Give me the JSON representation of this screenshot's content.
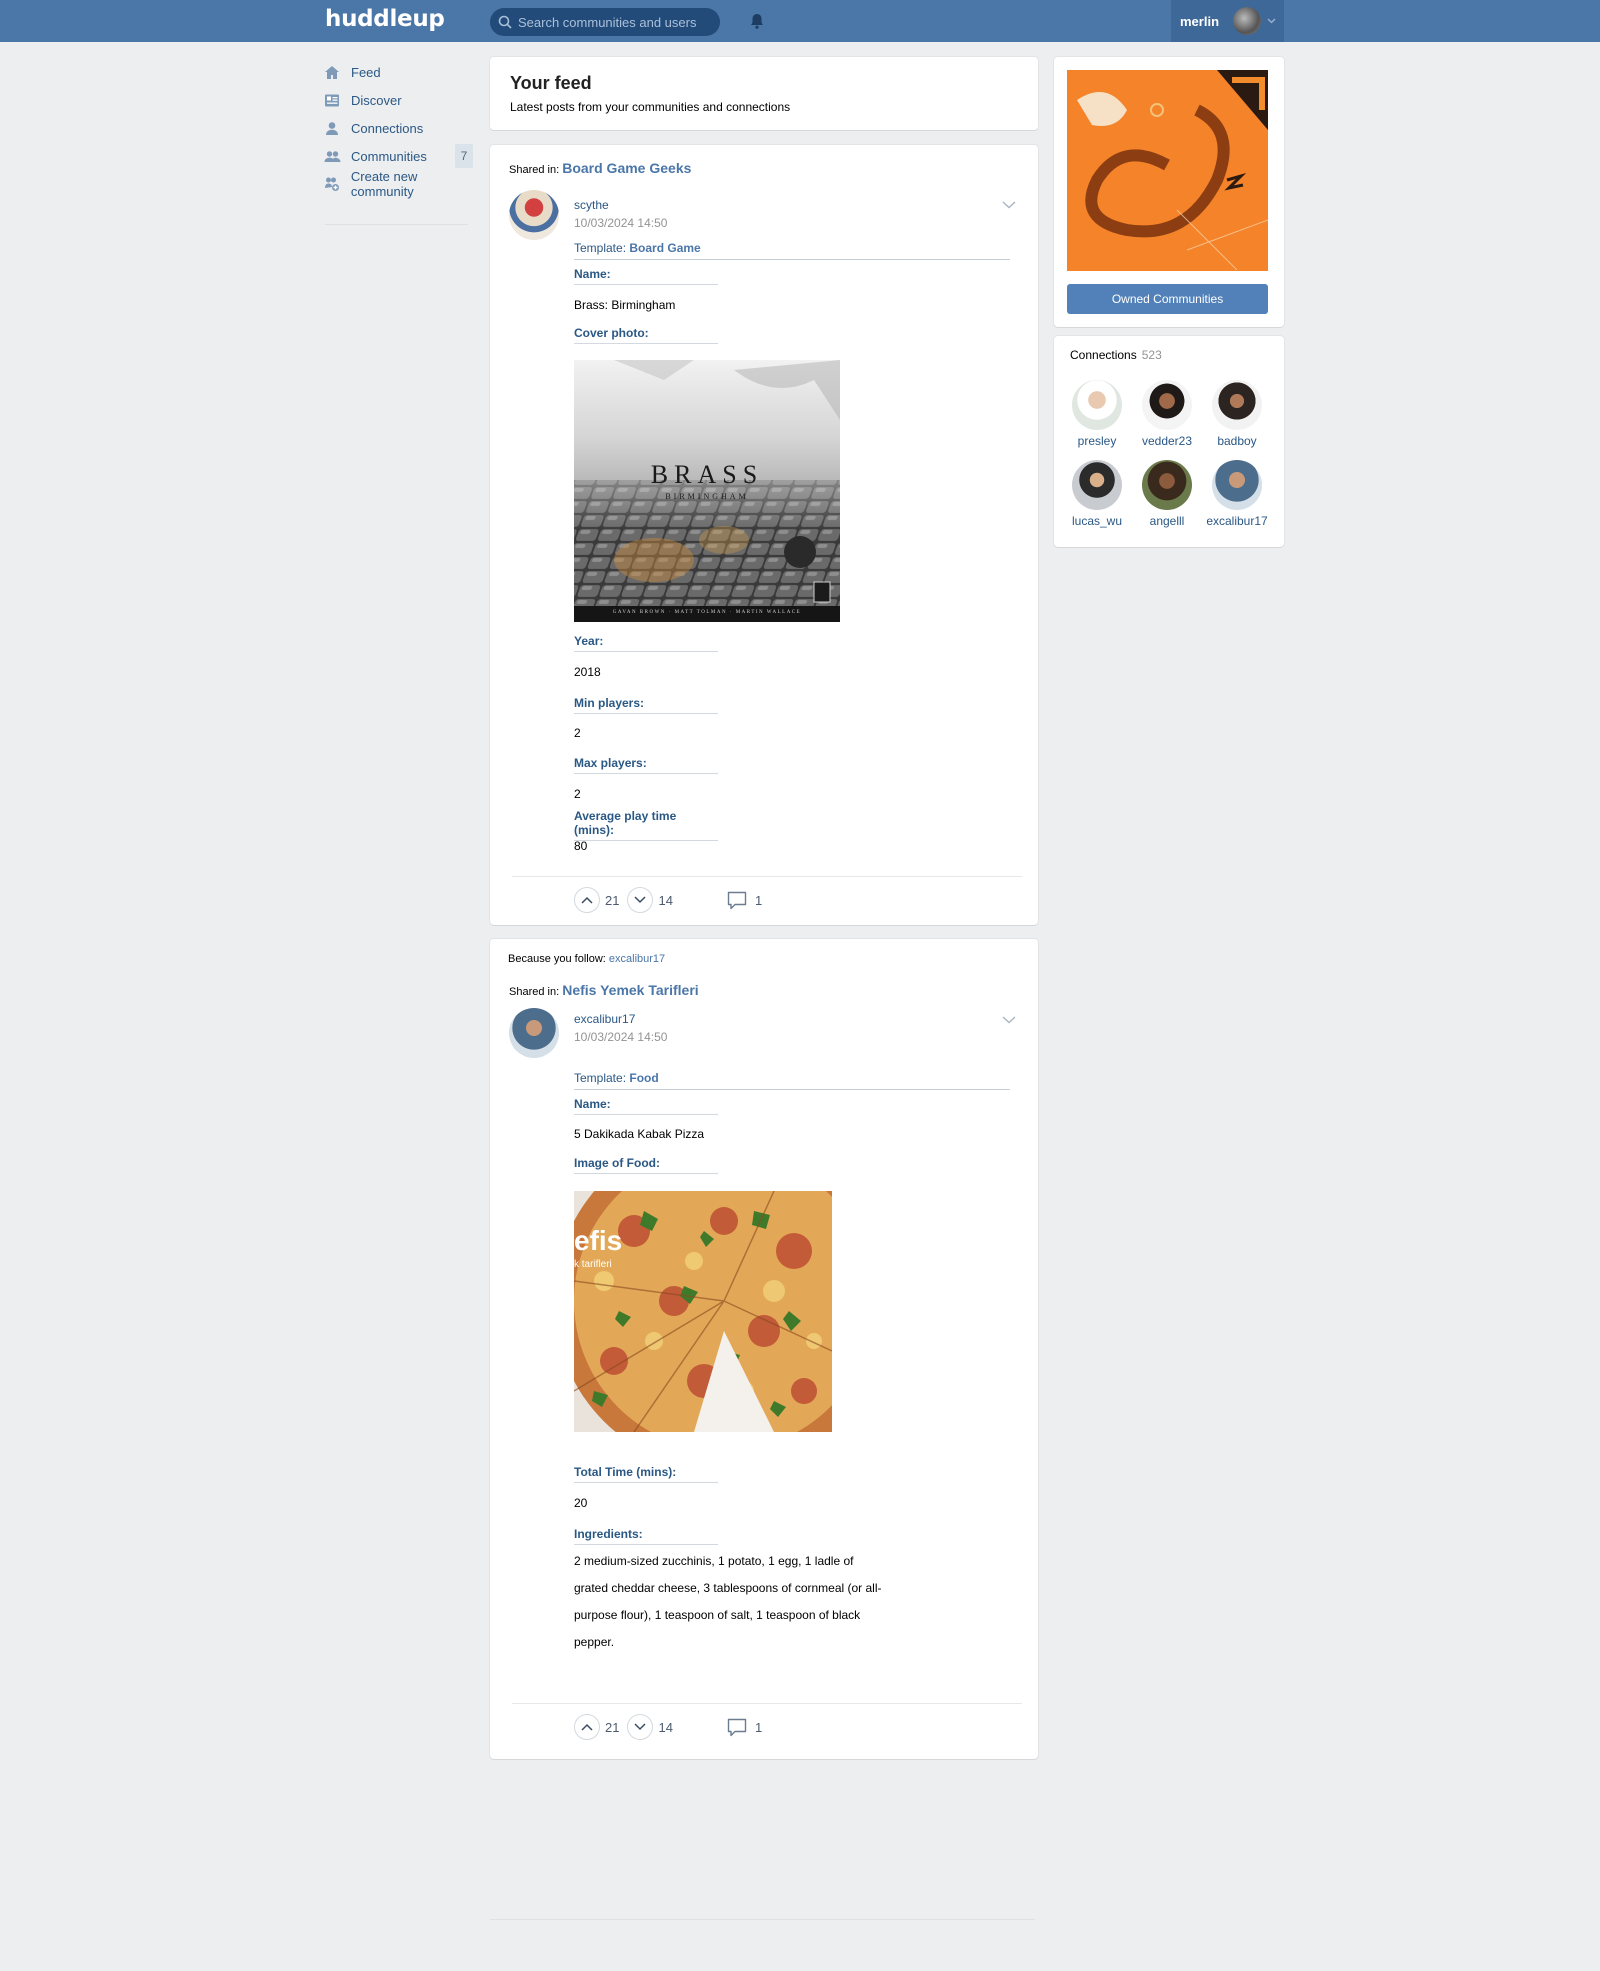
{
  "header": {
    "logo": "huddleup",
    "search_placeholder": "Search communities and users",
    "username": "merlin"
  },
  "nav": {
    "items": [
      {
        "label": "Feed",
        "icon": "home-icon"
      },
      {
        "label": "Discover",
        "icon": "newspaper-icon"
      },
      {
        "label": "Connections",
        "icon": "user-icon"
      },
      {
        "label": "Communities",
        "icon": "users-icon",
        "count": "7"
      },
      {
        "label": "Create new community",
        "icon": "create-community-icon"
      }
    ]
  },
  "feed": {
    "title": "Your feed",
    "subtitle": "Latest posts from your communities and connections"
  },
  "posts": [
    {
      "shared_prefix": "Shared in:",
      "community": "Board Game Geeks",
      "author": "scythe",
      "date": "10/03/2024 14:50",
      "template_prefix": "Template:",
      "template": "Board Game",
      "fields": [
        {
          "label": "Name:",
          "value": "Brass: Birmingham"
        },
        {
          "label": "Cover photo:"
        },
        {
          "label": "Year:",
          "value": "2018"
        },
        {
          "label": "Min players:",
          "value": "2"
        },
        {
          "label": "Max players:",
          "value": "2"
        },
        {
          "label": "Average play time (mins):",
          "value": "80"
        }
      ],
      "cover_title": "BRASS",
      "cover_subtitle": "BIRMINGHAM",
      "cover_credits": "GAVAN BROWN · MATT TOLMAN · MARTIN WALLACE",
      "upvotes": "21",
      "downvotes": "14",
      "comments": "1"
    },
    {
      "follow_prefix": "Because you follow:",
      "follow_user": "excalibur17",
      "shared_prefix": "Shared in:",
      "community": "Nefis Yemek Tarifleri",
      "author": "excalibur17",
      "date": "10/03/2024 14:50",
      "template_prefix": "Template:",
      "template": "Food",
      "fields": [
        {
          "label": "Name:",
          "value": "5 Dakikada Kabak Pizza"
        },
        {
          "label": "Image of Food:"
        },
        {
          "label": "Total Time (mins):",
          "value": "20"
        },
        {
          "label": "Ingredients:",
          "value": "2 medium-sized zucchinis, 1 potato, 1 egg, 1 ladle of grated cheddar cheese, 3 tablespoons of cornmeal (or all-purpose flour), 1 teaspoon of salt, 1 teaspoon of black pepper."
        }
      ],
      "image_watermark_1": "efis",
      "image_watermark_2": "k tarifleri",
      "upvotes": "21",
      "downvotes": "14",
      "comments": "1"
    }
  ],
  "sidebar": {
    "owned_button": "Owned Communities",
    "connections_title": "Connections",
    "connections_count": "523",
    "connections": [
      "presley",
      "vedder23",
      "badboy",
      "lucas_wu",
      "angelll",
      "excalibur17"
    ]
  },
  "colors": {
    "header_bg": "#4a76a8",
    "link": "#2a5885",
    "accent": "#4a76a8",
    "button": "#5181b8",
    "page_bg": "#edeef0"
  }
}
